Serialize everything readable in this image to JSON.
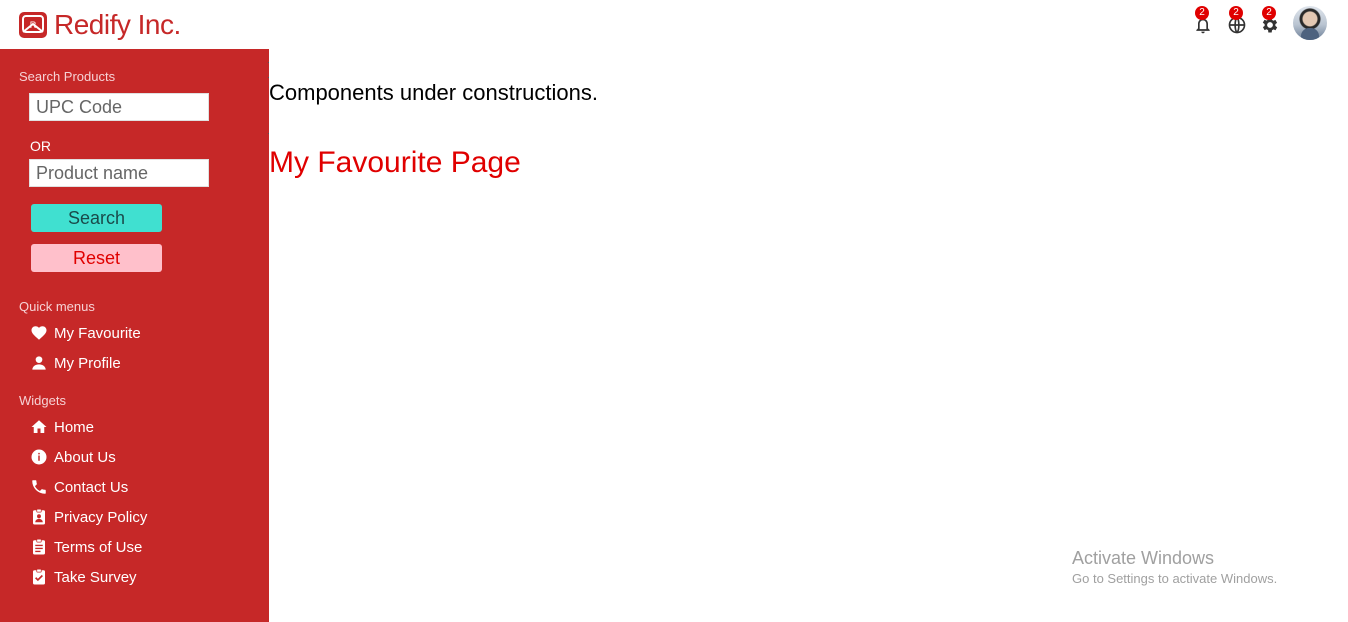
{
  "header": {
    "brand": "Redify Inc.",
    "notifications": [
      {
        "icon": "bell-icon",
        "count": "2"
      },
      {
        "icon": "globe-icon",
        "count": "2"
      },
      {
        "icon": "gear-icon",
        "count": "2"
      }
    ]
  },
  "sidebar": {
    "search_title": "Search Products",
    "upc_placeholder": "UPC Code",
    "or_label": "OR",
    "name_placeholder": "Product name",
    "search_label": "Search",
    "reset_label": "Reset",
    "quick_title": "Quick menus",
    "quick_items": [
      {
        "label": "My Favourite",
        "icon": "heart-icon"
      },
      {
        "label": "My Profile",
        "icon": "person-icon"
      }
    ],
    "widgets_title": "Widgets",
    "widget_items": [
      {
        "label": "Home",
        "icon": "home-icon"
      },
      {
        "label": "About Us",
        "icon": "info-icon"
      },
      {
        "label": "Contact Us",
        "icon": "phone-icon"
      },
      {
        "label": "Privacy Policy",
        "icon": "badge-icon"
      },
      {
        "label": "Terms of Use",
        "icon": "clipboard-icon"
      },
      {
        "label": "Take Survey",
        "icon": "clipboard-check-icon"
      }
    ]
  },
  "main": {
    "construction_text": "Components under constructions.",
    "page_title": "My Favourite Page"
  },
  "watermark": {
    "title": "Activate Windows",
    "subtitle": "Go to Settings to activate Windows."
  },
  "colors": {
    "brand": "#c62828",
    "search_button": "#40e0d0",
    "reset_button": "#ffc0cb",
    "title_red": "#e00000"
  }
}
